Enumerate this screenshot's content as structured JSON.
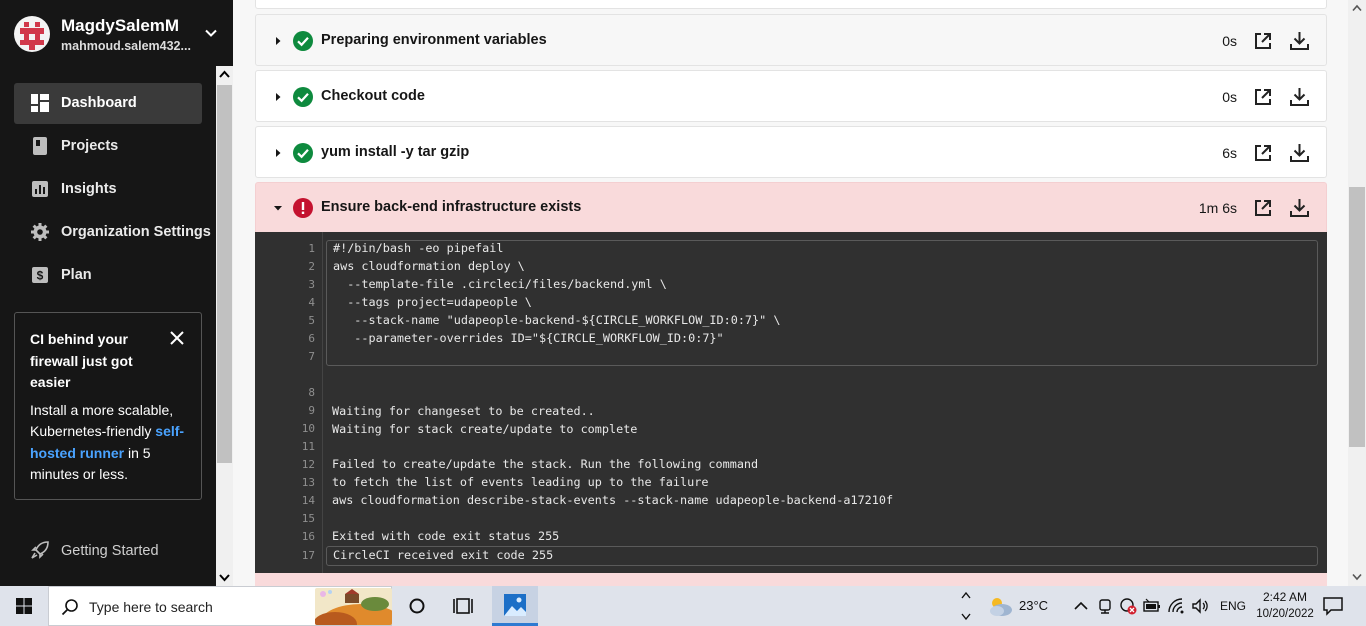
{
  "user": {
    "name": "MagdySalemM",
    "email": "mahmoud.salem432..."
  },
  "nav": {
    "items": [
      {
        "label": "Dashboard",
        "icon": "dashboard-icon",
        "active": true
      },
      {
        "label": "Projects",
        "icon": "projects-icon",
        "active": false
      },
      {
        "label": "Insights",
        "icon": "insights-icon",
        "active": false
      },
      {
        "label": "Organization Settings",
        "icon": "gear-icon",
        "active": false
      },
      {
        "label": "Plan",
        "icon": "dollar-icon",
        "active": false
      }
    ]
  },
  "promo": {
    "title": "CI behind your firewall just got easier",
    "body_prefix": "Install a more scalable, Kubernetes-friendly ",
    "link": "self-hosted runner",
    "body_suffix": " in 5 minutes or less."
  },
  "getting_started": {
    "label": "Getting Started",
    "icon": "rocket-icon"
  },
  "steps": [
    {
      "title": "Preparing environment variables",
      "duration": "0s",
      "status": "success"
    },
    {
      "title": "Checkout code",
      "duration": "0s",
      "status": "success"
    },
    {
      "title": "yum install -y tar gzip",
      "duration": "6s",
      "status": "success"
    },
    {
      "title": "Ensure back-end infrastructure exists",
      "duration": "1m 6s",
      "status": "failed",
      "expanded": true
    }
  ],
  "colors": {
    "success": "#0e8a3e",
    "failed": "#c4122f",
    "failed_bg": "#f9dadb",
    "sidebar_bg": "#161616",
    "terminal_bg": "#303030",
    "link": "#4aa3ff"
  },
  "terminal": {
    "command_lines": [
      {
        "n": "1",
        "text": "#!/bin/bash -eo pipefail"
      },
      {
        "n": "2",
        "text": "aws cloudformation deploy \\"
      },
      {
        "n": "3",
        "text": "  --template-file .circleci/files/backend.yml \\"
      },
      {
        "n": "4",
        "text": "  --tags project=udapeople \\"
      },
      {
        "n": "5",
        "text": "   --stack-name \"udapeople-backend-${CIRCLE_WORKFLOW_ID:0:7}\" \\"
      },
      {
        "n": "6",
        "text": "   --parameter-overrides ID=\"${CIRCLE_WORKFLOW_ID:0:7}\""
      },
      {
        "n": "7",
        "text": ""
      }
    ],
    "output_lines": [
      {
        "n": "8",
        "text": ""
      },
      {
        "n": "9",
        "text": "Waiting for changeset to be created.."
      },
      {
        "n": "10",
        "text": "Waiting for stack create/update to complete"
      },
      {
        "n": "11",
        "text": ""
      },
      {
        "n": "12",
        "text": "Failed to create/update the stack. Run the following command"
      },
      {
        "n": "13",
        "text": "to fetch the list of events leading up to the failure"
      },
      {
        "n": "14",
        "text": "aws cloudformation describe-stack-events --stack-name udapeople-backend-a17210f"
      },
      {
        "n": "15",
        "text": ""
      },
      {
        "n": "16",
        "text": "Exited with code exit status 255"
      }
    ],
    "exit_line": {
      "n": "17",
      "text": "CircleCI received exit code 255"
    }
  },
  "taskbar": {
    "search_placeholder": "Type here to search",
    "temperature": "23°C",
    "language": "ENG",
    "time": "2:42 AM",
    "date": "10/20/2022",
    "apps": [
      "windows-start-icon",
      "cortana-icon",
      "task-view-icon",
      "photos-app-icon"
    ],
    "tray": [
      "weather-icon",
      "show-hidden-icons-chevron",
      "meet-now-icon",
      "antivirus-icon",
      "battery-icon",
      "wifi-icon",
      "volume-icon",
      "notification-icon"
    ]
  }
}
